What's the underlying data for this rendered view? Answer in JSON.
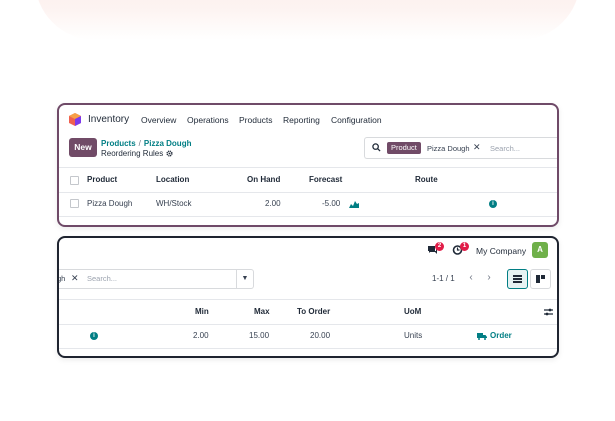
{
  "header": {
    "app_name": "Inventory",
    "menu": [
      "Overview",
      "Operations",
      "Products",
      "Reporting",
      "Configuration"
    ]
  },
  "control_panel": {
    "new_label": "New",
    "breadcrumb": [
      "Products",
      "Pizza Dough"
    ],
    "breadcrumb_sep": "/",
    "subtitle": "Reordering Rules",
    "search": {
      "facet_label": "Product",
      "facet_value": "Pizza Dough",
      "placeholder": "Search...",
      "facet_value_cut": "gh"
    }
  },
  "table": {
    "columns_left": [
      "Product",
      "Location",
      "On Hand",
      "Forecast",
      "Route"
    ],
    "columns_right": [
      "Min",
      "Max",
      "To Order",
      "UoM"
    ],
    "row": {
      "product": "Pizza Dough",
      "location": "WH/Stock",
      "on_hand": "2.00",
      "forecast": "-5.00",
      "min": "2.00",
      "max": "15.00",
      "to_order": "20.00",
      "uom": "Units",
      "order_label": "Order"
    }
  },
  "systray": {
    "messages_count": "2",
    "activities_count": "1",
    "company": "My Company",
    "avatar_letter": "A"
  },
  "pager": {
    "text": "1-1 / 1"
  },
  "colors": {
    "brand": "#714b67",
    "teal": "#017e84",
    "danger": "#e11d48",
    "avatar": "#6fb04a"
  }
}
